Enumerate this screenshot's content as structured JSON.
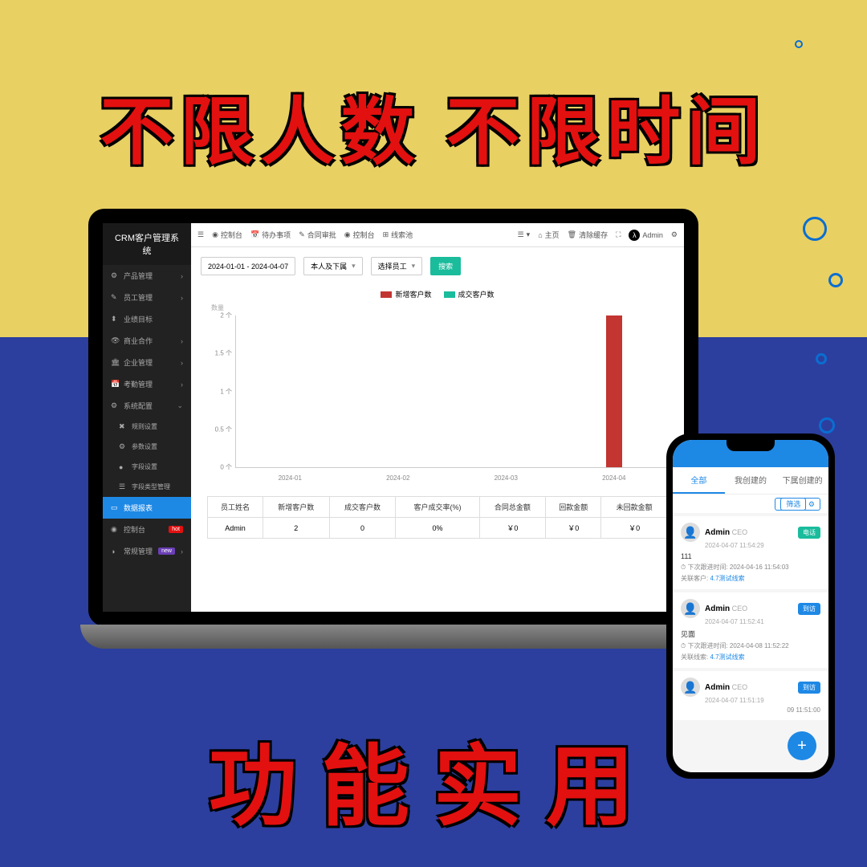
{
  "marketing": {
    "headline1": "不限人数 不限时间",
    "headline2": "功能实用"
  },
  "app": {
    "title": "CRM客户管理系统",
    "sidebar": [
      {
        "icon": "⚙",
        "label": "产品管理",
        "arrow": "›"
      },
      {
        "icon": "✎",
        "label": "员工管理",
        "arrow": "›"
      },
      {
        "icon": "⬍",
        "label": "业绩目标"
      },
      {
        "icon": "👁",
        "label": "商业合作",
        "arrow": "›"
      },
      {
        "icon": "🏛",
        "label": "企业管理",
        "arrow": "›"
      },
      {
        "icon": "📅",
        "label": "考勤管理",
        "arrow": "›"
      },
      {
        "icon": "⚙",
        "label": "系统配置",
        "arrow": "⌄"
      },
      {
        "icon": "✖",
        "label": "规则设置",
        "sub": true
      },
      {
        "icon": "⚙",
        "label": "参数设置",
        "sub": true
      },
      {
        "icon": "●",
        "label": "字段设置",
        "sub": true
      },
      {
        "icon": "☰",
        "label": "字段类型管理",
        "sub": true
      },
      {
        "icon": "▭",
        "label": "数据报表",
        "active": true
      },
      {
        "icon": "◉",
        "label": "控制台",
        "badge": "hot",
        "badge_text": "hot"
      },
      {
        "icon": "◑",
        "label": "常规管理",
        "badge": "new",
        "badge_text": "new",
        "arrow": "›"
      }
    ],
    "topbar": {
      "left": [
        {
          "icon": "☰"
        },
        {
          "icon": "◉",
          "label": "控制台"
        },
        {
          "icon": "📅",
          "label": "待办事项"
        },
        {
          "icon": "✎",
          "label": "合同审批"
        },
        {
          "icon": "◉",
          "label": "控制台"
        },
        {
          "icon": "⊞",
          "label": "线索池"
        }
      ],
      "right": [
        {
          "icon": "☰",
          "caret": "▾"
        },
        {
          "icon": "⌂",
          "label": "主页"
        },
        {
          "icon": "🗑",
          "label": "清除缓存"
        },
        {
          "icon": "⛶"
        },
        {
          "avatar": "λ",
          "label": "Admin"
        },
        {
          "icon": "⚙"
        }
      ]
    },
    "filters": {
      "date_range": "2024-01-01 - 2024-04-07",
      "scope": "本人及下属",
      "employee": "选择员工",
      "search": "搜索"
    },
    "legend": {
      "series1": {
        "color": "#c23531",
        "label": "新增客户数"
      },
      "series2": {
        "color": "#1abc9c",
        "label": "成交客户数"
      }
    },
    "chart_ylabel": "数量",
    "chart_data": {
      "type": "bar",
      "ylabel": "数量",
      "categories": [
        "2024-01",
        "2024-02",
        "2024-03",
        "2024-04"
      ],
      "series": [
        {
          "name": "新增客户数",
          "values": [
            0,
            0,
            0,
            2
          ]
        },
        {
          "name": "成交客户数",
          "values": [
            0,
            0,
            0,
            0
          ]
        }
      ],
      "yticks": [
        "0 个",
        "0.5 个",
        "1 个",
        "1.5 个",
        "2 个"
      ],
      "ylim": [
        0,
        2
      ]
    },
    "table": {
      "headers": [
        "员工姓名",
        "新增客户数",
        "成交客户数",
        "客户成交率(%)",
        "合同总金额",
        "回款金额",
        "未回款金额"
      ],
      "rows": [
        [
          "Admin",
          "2",
          "0",
          "0%",
          "￥0",
          "￥0",
          "￥0"
        ]
      ]
    }
  },
  "phone": {
    "tabs": [
      "全部",
      "我创建的",
      "下属创建的"
    ],
    "filter": "筛选",
    "cards": [
      {
        "name": "Admin",
        "role": "CEO",
        "tag": "电话",
        "tag_color": "green",
        "time": "2024-04-07 11:54:29",
        "body": "111",
        "next_label": "下次跟进时间:",
        "next": "2024-04-16 11:54:03",
        "rel_label": "关联客户:",
        "rel": "4.7测试线索"
      },
      {
        "name": "Admin",
        "role": "CEO",
        "tag": "到访",
        "tag_color": "blue",
        "time": "2024-04-07 11:52:41",
        "body": "见面",
        "next_label": "下次跟进时间:",
        "next": "2024-04-08 11:52:22",
        "rel_label": "关联线索:",
        "rel": "4.7测试线索"
      },
      {
        "name": "Admin",
        "role": "CEO",
        "tag": "到访",
        "tag_color": "blue",
        "time": "2024-04-07 11:51:19",
        "body": "",
        "next_label": "",
        "next": "09 11:51:00",
        "rel_label": "",
        "rel": ""
      }
    ]
  }
}
